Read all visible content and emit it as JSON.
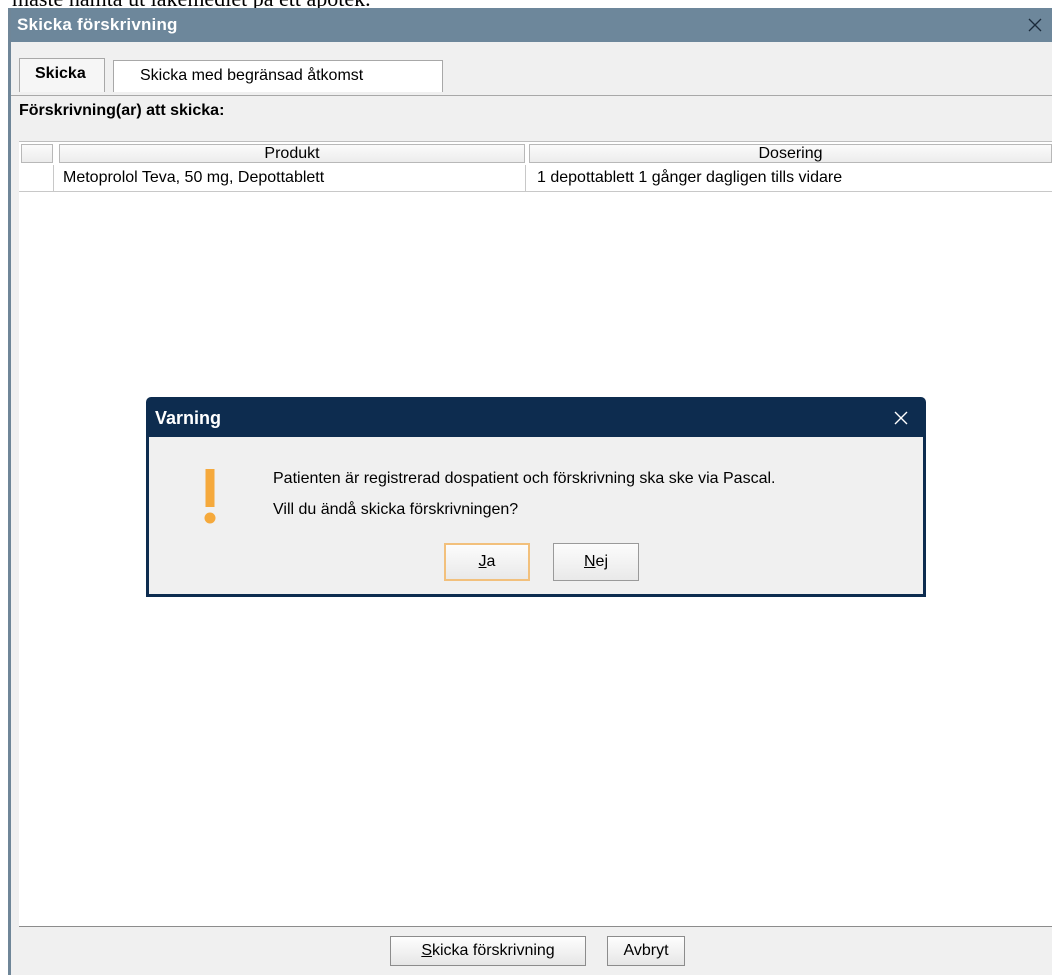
{
  "top_caption": "måste hämta ut läkemedlet på ett apotek.",
  "window": {
    "title": "Skicka förskrivning",
    "close_glyph": "✕"
  },
  "tabs": [
    {
      "label": "Skicka",
      "active": true
    },
    {
      "label": "Skicka med begränsad åtkomst",
      "active": false
    }
  ],
  "section_label": "Förskrivning(ar) att skicka:",
  "table": {
    "columns": [
      "",
      "Produkt",
      "Dosering"
    ],
    "rows": [
      {
        "produkt": "Metoprolol Teva, 50 mg, Depottablett",
        "dosering": "1 depottablett 1 gånger dagligen tills vidare"
      }
    ]
  },
  "footer": {
    "send": {
      "mnemonic": "S",
      "rest": "kicka förskrivning"
    },
    "cancel": "Avbryt"
  },
  "dialog": {
    "title": "Varning",
    "icon": "warning-exclamation-icon",
    "icon_color": "#f5a93c",
    "message_line1": "Patienten är registrerad dospatient och förskrivning ska ske via Pascal.",
    "message_line2": "Vill du ändå skicka förskrivningen?",
    "yes": {
      "mnemonic": "J",
      "rest": "a"
    },
    "no": {
      "mnemonic": "N",
      "rest": "ej"
    }
  },
  "colors": {
    "window_titlebar": "#6d879b",
    "dialog_titlebar": "#0d2c4f",
    "default_button_focus": "#f2c07c"
  }
}
